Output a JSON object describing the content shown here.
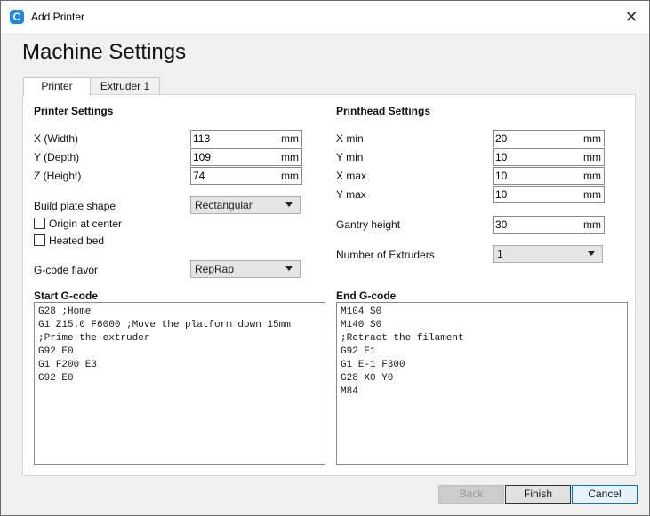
{
  "window": {
    "title": "Add Printer",
    "close_glyph": "✕",
    "app_icon_letter": "C"
  },
  "heading": "Machine Settings",
  "tabs": [
    {
      "label": "Printer"
    },
    {
      "label": "Extruder 1"
    }
  ],
  "printer_settings": {
    "title": "Printer Settings",
    "x": {
      "label": "X (Width)",
      "value": "113",
      "unit": "mm"
    },
    "y": {
      "label": "Y (Depth)",
      "value": "109",
      "unit": "mm"
    },
    "z": {
      "label": "Z (Height)",
      "value": "74",
      "unit": "mm"
    },
    "build_plate": {
      "label": "Build plate shape",
      "value": "Rectangular"
    },
    "origin_center": {
      "label": "Origin at center",
      "checked": false
    },
    "heated_bed": {
      "label": "Heated bed",
      "checked": false
    },
    "gcode_flavor": {
      "label": "G-code flavor",
      "value": "RepRap"
    }
  },
  "printhead_settings": {
    "title": "Printhead Settings",
    "x_min": {
      "label": "X min",
      "value": "20",
      "unit": "mm"
    },
    "y_min": {
      "label": "Y min",
      "value": "10",
      "unit": "mm"
    },
    "x_max": {
      "label": "X max",
      "value": "10",
      "unit": "mm"
    },
    "y_max": {
      "label": "Y max",
      "value": "10",
      "unit": "mm"
    },
    "gantry": {
      "label": "Gantry height",
      "value": "30",
      "unit": "mm"
    },
    "extruders": {
      "label": "Number of Extruders",
      "value": "1"
    }
  },
  "start_gcode": {
    "title": "Start G-code",
    "lines": [
      "G28 ;Home",
      "G1 Z15.0 F6000 ;Move the platform down 15mm",
      ";Prime the extruder",
      "G92 E0",
      "G1 F200 E3",
      "G92 E0"
    ]
  },
  "end_gcode": {
    "title": "End G-code",
    "lines": [
      "M104 S0",
      "M140 S0",
      ";Retract the filament",
      "G92 E1",
      "G1 E-1 F300",
      "G28 X0 Y0",
      "M84"
    ]
  },
  "buttons": {
    "back": "Back",
    "finish": "Finish",
    "cancel": "Cancel"
  },
  "colors": {
    "accent": "#0078d7",
    "app_icon": "#1e88e5"
  }
}
